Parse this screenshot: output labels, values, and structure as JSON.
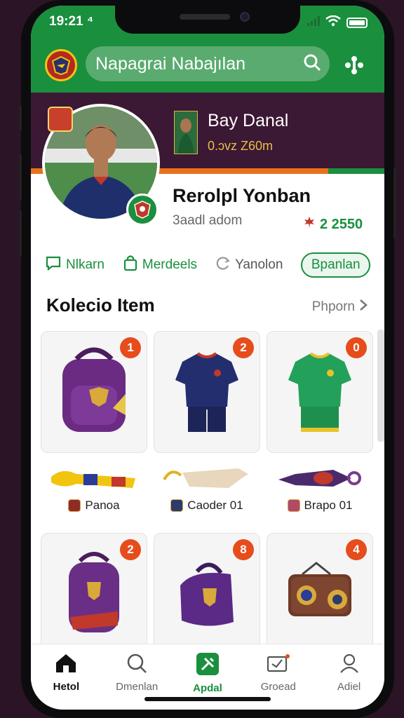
{
  "status": {
    "time": "19:21 ⁴"
  },
  "header": {
    "search_text": "Napagrai Nabajılan",
    "icons": [
      "club-logo-icon",
      "search-icon",
      "apps-menu-icon"
    ]
  },
  "profile": {
    "card_name": "Bay Danal",
    "card_sub": "0.ᴐvz Z60m",
    "name": "Rerolpl Yonban",
    "subtitle": "3aadl adom",
    "points": "2 2550",
    "points_icon": "maple-leaf-icon"
  },
  "actions": {
    "items": [
      {
        "label": "Nlkarn",
        "icon": "chat-icon"
      },
      {
        "label": "Merdeels",
        "icon": "bag-icon"
      },
      {
        "label": "Yanolon",
        "icon": "refresh-icon"
      }
    ],
    "button": "Bpanlan"
  },
  "section": {
    "title": "Kolecio Item",
    "see_all": "Phporn"
  },
  "items_row1": [
    {
      "badge": "1",
      "kind": "backpack"
    },
    {
      "badge": "2",
      "kind": "navy-kit"
    },
    {
      "badge": "0",
      "kind": "green-kit"
    }
  ],
  "strips": [
    {
      "label": "Panoa",
      "kind": "scarf"
    },
    {
      "label": "Caoder 01",
      "kind": "glove"
    },
    {
      "label": "Brapo 01",
      "kind": "keychain"
    }
  ],
  "items_row2": [
    {
      "badge": "2",
      "kind": "backpack2"
    },
    {
      "badge": "8",
      "kind": "backpack3"
    },
    {
      "badge": "4",
      "kind": "radio"
    }
  ],
  "tabs": [
    {
      "label": "Hetol",
      "icon": "home-icon",
      "state": "current"
    },
    {
      "label": "Dmenlan",
      "icon": "search-icon",
      "state": "normal"
    },
    {
      "label": "Apdal",
      "icon": "wrench-icon",
      "state": "active"
    },
    {
      "label": "Groead",
      "icon": "inbox-icon",
      "state": "normal"
    },
    {
      "label": "Adiel",
      "icon": "person-icon",
      "state": "normal"
    }
  ],
  "colors": {
    "brand_green": "#1a8f3d",
    "band_purple": "#3b1833",
    "accent_orange": "#e8701b",
    "badge_red": "#e74c1c"
  }
}
